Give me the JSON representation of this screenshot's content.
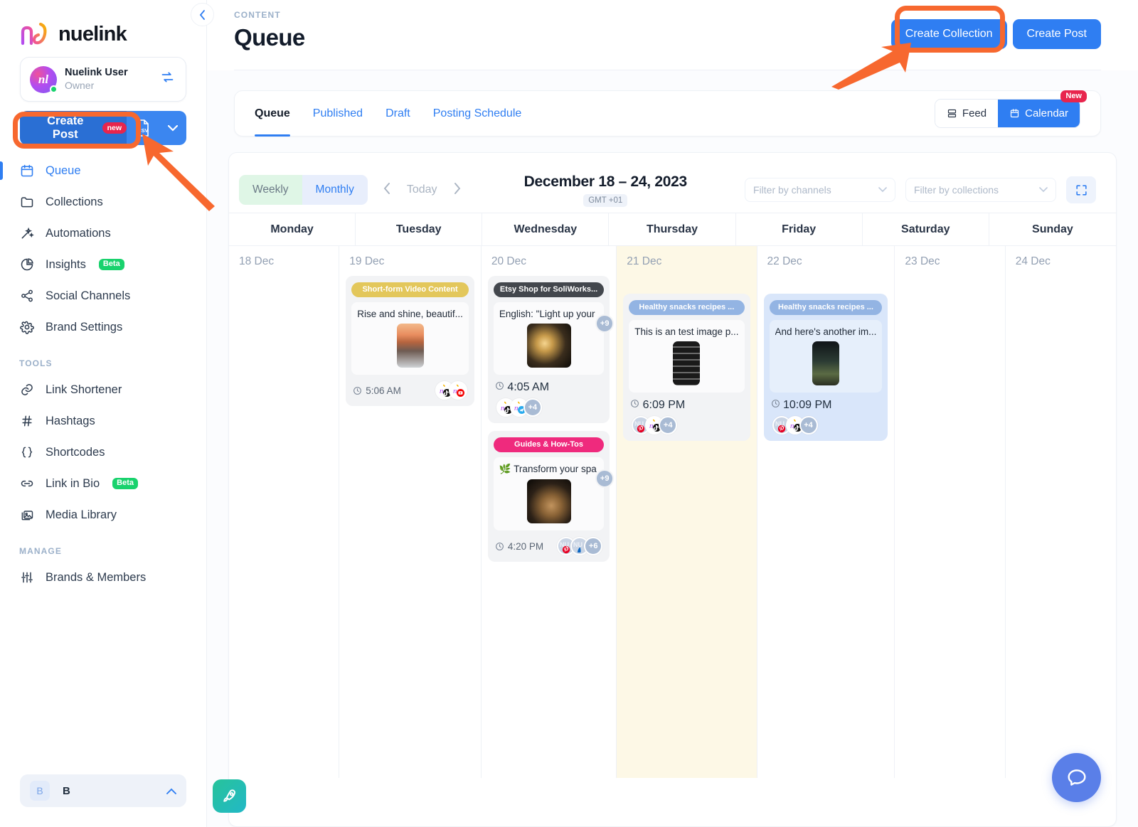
{
  "sidebar": {
    "brand_name": "nuelink",
    "brand_logo_glyph": "nl",
    "account": {
      "name": "Nuelink User",
      "role": "Owner",
      "avatar_glyph": "nl"
    },
    "create_post": {
      "label": "Create Post",
      "badge": "new"
    },
    "csv_label": "CSV",
    "nav_main": [
      {
        "label": "Queue",
        "icon": "calendar-icon",
        "active": true
      },
      {
        "label": "Collections",
        "icon": "folder-icon",
        "active": false
      },
      {
        "label": "Automations",
        "icon": "magic-wand-icon",
        "active": false
      },
      {
        "label": "Insights",
        "icon": "pie-chart-icon",
        "badge": "Beta",
        "active": false
      },
      {
        "label": "Social Channels",
        "icon": "share-nodes-icon",
        "active": false
      },
      {
        "label": "Brand Settings",
        "icon": "gear-icon",
        "active": false
      }
    ],
    "section_tools": "TOOLS",
    "nav_tools": [
      {
        "label": "Link Shortener",
        "icon": "link-icon"
      },
      {
        "label": "Hashtags",
        "icon": "hash-icon"
      },
      {
        "label": "Shortcodes",
        "icon": "braces-icon"
      },
      {
        "label": "Link in Bio",
        "icon": "link-chain-icon",
        "badge": "Beta"
      },
      {
        "label": "Media Library",
        "icon": "images-icon"
      }
    ],
    "section_manage": "MANAGE",
    "nav_manage": [
      {
        "label": "Brands & Members",
        "icon": "sliders-icon"
      }
    ],
    "brand_switcher": {
      "initial": "B",
      "label": "B"
    }
  },
  "header": {
    "eyebrow": "CONTENT",
    "title": "Queue",
    "create_collection": "Create Collection",
    "create_post": "Create Post"
  },
  "tabs": {
    "items": [
      {
        "label": "Queue",
        "active": true
      },
      {
        "label": "Published",
        "active": false
      },
      {
        "label": "Draft",
        "active": false
      },
      {
        "label": "Posting Schedule",
        "active": false
      }
    ],
    "view_feed": "Feed",
    "view_calendar": "Calendar",
    "new_badge": "New"
  },
  "calendar": {
    "weekly_label": "Weekly",
    "monthly_label": "Monthly",
    "today_label": "Today",
    "range": "December 18 – 24, 2023",
    "timezone": "GMT +01",
    "filter_channels_placeholder": "Filter by channels",
    "filter_collections_placeholder": "Filter by collections",
    "day_headers": [
      "Monday",
      "Tuesday",
      "Wednesday",
      "Thursday",
      "Friday",
      "Saturday",
      "Sunday"
    ],
    "days": [
      {
        "date_label": "18 Dec",
        "highlight": false,
        "posts": []
      },
      {
        "date_label": "19 Dec",
        "highlight": false,
        "posts": [
          {
            "collection": "Short-form Video Content",
            "chip_style": "yellow",
            "text": "Rise and shine, beautif...",
            "time": "5:06 AM",
            "thumb_style": "portrait-beach",
            "avatars": [
              "nuelink-tiktok-avatar",
              "nuelink-youtube-avatar"
            ],
            "more_count": "",
            "card_style": "grey",
            "meta_layout": "inline"
          }
        ]
      },
      {
        "date_label": "20 Dec",
        "highlight": false,
        "posts": [
          {
            "collection": "Etsy Shop for SoliWorks...",
            "chip_style": "dark",
            "text": "English: \"Light up your",
            "time": "4:05 AM",
            "thumb_style": "square-lamps",
            "avatars": [
              "nuelink-tiktok-avatar",
              "nuelink-telegram-avatar"
            ],
            "more_count": "+4",
            "float_count": "+9",
            "card_style": "grey",
            "meta_layout": "stacked"
          },
          {
            "collection": "Guides & How-Tos",
            "chip_style": "pink",
            "text": "🌿 Transform your spa",
            "time": "4:20 PM",
            "thumb_style": "square-vase",
            "avatars": [
              "nuelink-pinterest-avatar",
              "nuelink-linkedin-avatar"
            ],
            "more_count": "+6",
            "float_count": "+9",
            "card_style": "grey",
            "meta_layout": "inline"
          }
        ]
      },
      {
        "date_label": "21 Dec",
        "highlight": true,
        "posts": [
          {
            "collection": "Healthy snacks recipes ...",
            "chip_style": "periwinkle",
            "text": "This is an test image p...",
            "time": "6:09 PM",
            "thumb_style": "portrait-text",
            "avatars": [
              "nuelink-pinterest-avatar",
              "nuelink-tiktok-avatar"
            ],
            "more_count": "+4",
            "card_style": "grey",
            "meta_layout": "stacked"
          }
        ]
      },
      {
        "date_label": "22 Dec",
        "highlight": false,
        "posts": [
          {
            "collection": "Healthy snacks recipes ...",
            "chip_style": "periwinkle",
            "text": "And here's another im...",
            "time": "10:09 PM",
            "thumb_style": "portrait-city",
            "avatars": [
              "nuelink-pinterest-avatar",
              "nuelink-tiktok-avatar"
            ],
            "more_count": "+4",
            "card_style": "blue",
            "meta_layout": "stacked"
          }
        ]
      },
      {
        "date_label": "23 Dec",
        "highlight": false,
        "posts": []
      },
      {
        "date_label": "24 Dec",
        "highlight": false,
        "posts": []
      }
    ]
  },
  "colors": {
    "accent_blue": "#2f7ef2",
    "create_post_blue": "#2a6fd4",
    "annotation_orange": "#f7682f",
    "badge_red": "#e8254d",
    "badge_green": "#19d26d",
    "today_highlight": "#fdf8e6",
    "blue_card": "#d9e6fa"
  }
}
